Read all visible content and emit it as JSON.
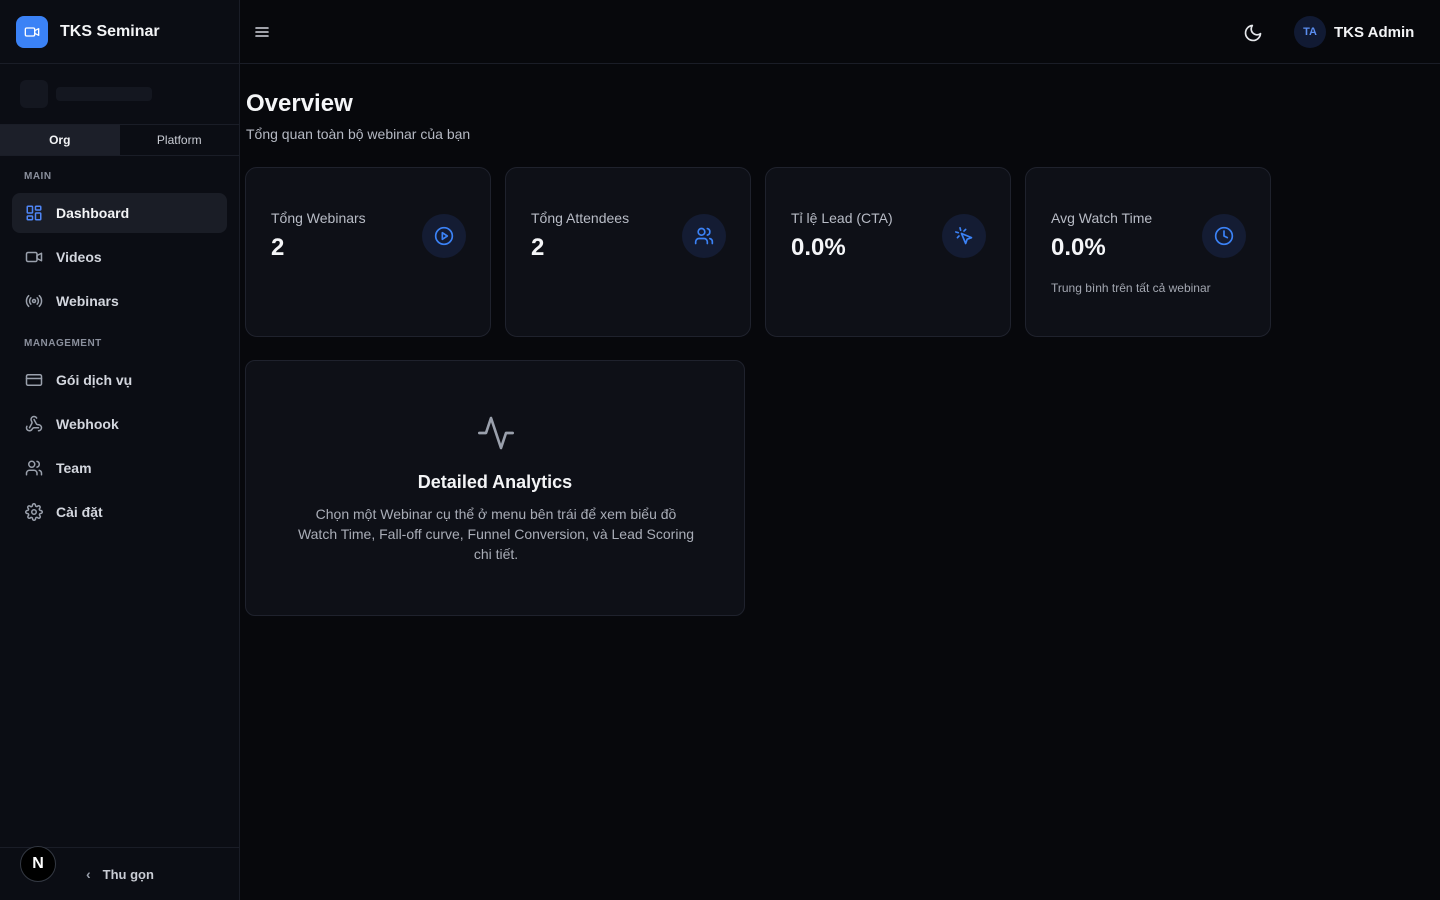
{
  "brand": {
    "name": "TKS Seminar"
  },
  "scope_toggle": {
    "org": "Org",
    "platform": "Platform",
    "selected": "Org"
  },
  "sidebar": {
    "main_label": "MAIN",
    "main_items": [
      {
        "label": "Dashboard",
        "icon": "layout-grid-icon",
        "active": true
      },
      {
        "label": "Videos",
        "icon": "video-icon"
      },
      {
        "label": "Webinars",
        "icon": "broadcast-icon"
      }
    ],
    "management_label": "MANAGEMENT",
    "management_items": [
      {
        "label": "Gói dịch vụ",
        "icon": "credit-card-icon"
      },
      {
        "label": "Webhook",
        "icon": "webhook-icon"
      },
      {
        "label": "Team",
        "icon": "users-icon"
      },
      {
        "label": "Cài đặt",
        "icon": "settings-icon"
      }
    ],
    "collapse_label": "Thu gọn",
    "badge_letter": "N"
  },
  "header": {
    "user_initials": "TA",
    "user_name": "TKS Admin"
  },
  "page": {
    "title": "Overview",
    "subtitle": "Tổng quan toàn bộ webinar của bạn"
  },
  "stats": [
    {
      "label": "Tổng Webinars",
      "value": "2",
      "icon": "play-circle-icon"
    },
    {
      "label": "Tổng Attendees",
      "value": "2",
      "icon": "users-icon"
    },
    {
      "label": "Tỉ lệ Lead (CTA)",
      "value": "0.0%",
      "icon": "pointer-click-icon"
    },
    {
      "label": "Avg Watch Time",
      "value": "0.0%",
      "icon": "clock-icon",
      "note": "Trung bình trên tất cả webinar"
    }
  ],
  "analytics": {
    "title": "Detailed Analytics",
    "description": "Chọn một Webinar cụ thể ở menu bên trái để xem biểu đồ Watch Time, Fall-off curve, Funnel Conversion, và Lead Scoring chi tiết."
  },
  "colors": {
    "accent": "#3b82f6",
    "background": "#07080c",
    "card": "#0e1017"
  }
}
